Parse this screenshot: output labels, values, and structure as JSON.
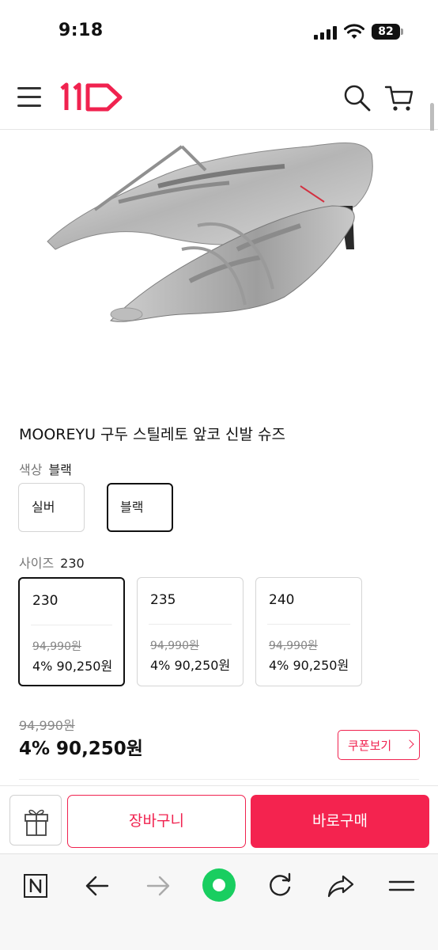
{
  "status_bar": {
    "time": "9:18",
    "battery": "82"
  },
  "header": {
    "logo_text": "11",
    "menu_icon": "menu-icon",
    "search_icon": "search-icon",
    "cart_icon": "cart-icon"
  },
  "product": {
    "title": "MOOREYU 구두 스틸레토 앞코 신발 슈즈",
    "image_alt": "silver lace-up stiletto pumps"
  },
  "color_option": {
    "label": "색상",
    "selected": "블랙",
    "choices": [
      "실버",
      "블랙"
    ]
  },
  "size_option": {
    "label": "사이즈",
    "selected": "230",
    "choices": [
      {
        "size": "230",
        "original_price": "94,990원",
        "price": "4% 90,250원"
      },
      {
        "size": "235",
        "original_price": "94,990원",
        "price": "4% 90,250원"
      },
      {
        "size": "240",
        "original_price": "94,990원",
        "price": "4% 90,250원"
      }
    ]
  },
  "price": {
    "original": "94,990원",
    "final": "4% 90,250원"
  },
  "coupon_button": "쿠폰보기",
  "purchase_bar": {
    "gift_icon": "gift-icon",
    "cart_label": "장바구니",
    "buy_label": "바로구매"
  },
  "browser_bar": {
    "icons": [
      "naver-icon",
      "back-arrow-icon",
      "forward-arrow-icon",
      "green-dot-icon",
      "reload-icon",
      "share-icon",
      "menu-icon"
    ]
  },
  "colors": {
    "accent": "#f0224f",
    "brand_green": "#19ce60"
  }
}
